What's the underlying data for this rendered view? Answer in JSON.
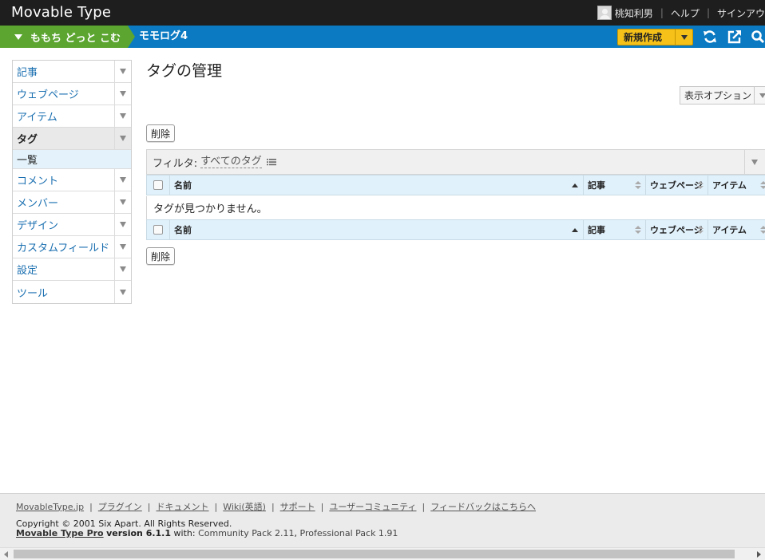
{
  "app": {
    "logo": "Movable Type"
  },
  "user": {
    "name": "桃知利男",
    "help": "ヘルプ",
    "signout": "サインアウ"
  },
  "nav": {
    "site": "ももち どっと こむ",
    "blog": "モモログ4",
    "new_button": "新規作成"
  },
  "sidebar": {
    "items": [
      {
        "label": "記事"
      },
      {
        "label": "ウェブページ"
      },
      {
        "label": "アイテム"
      },
      {
        "label": "タグ"
      },
      {
        "label": "コメント"
      },
      {
        "label": "メンバー"
      },
      {
        "label": "デザイン"
      },
      {
        "label": "カスタムフィールド"
      },
      {
        "label": "設定"
      },
      {
        "label": "ツール"
      }
    ],
    "sub_active": "一覧"
  },
  "main": {
    "title": "タグの管理",
    "display_options": "表示オプション",
    "delete_label": "削除",
    "filter_label": "フィルタ:",
    "filter_value": "すべてのタグ",
    "columns": [
      "名前",
      "記事",
      "ウェブページ",
      "アイテム"
    ],
    "empty_message": "タグが見つかりません。"
  },
  "footer": {
    "links": [
      "MovableType.jp",
      "プラグイン",
      "ドキュメント",
      "Wiki(英語)",
      "サポート",
      "ユーザーコミュニティ",
      "フィードバックはこちらへ"
    ],
    "copyright": "Copyright © 2001 Six Apart. All Rights Reserved.",
    "product": "Movable Type Pro",
    "version": "version 6.1.1",
    "with": "with:",
    "pack1": "Community Pack 2.11",
    "comma": ",",
    "pack2": "Professional Pack 1.91"
  },
  "colors": {
    "topbar": "#1e1e1e",
    "navbar": "#0b7ac2",
    "site_crumb": "#5ba530",
    "new_button": "#f6c21a",
    "table_header": "#e1f1fb"
  }
}
